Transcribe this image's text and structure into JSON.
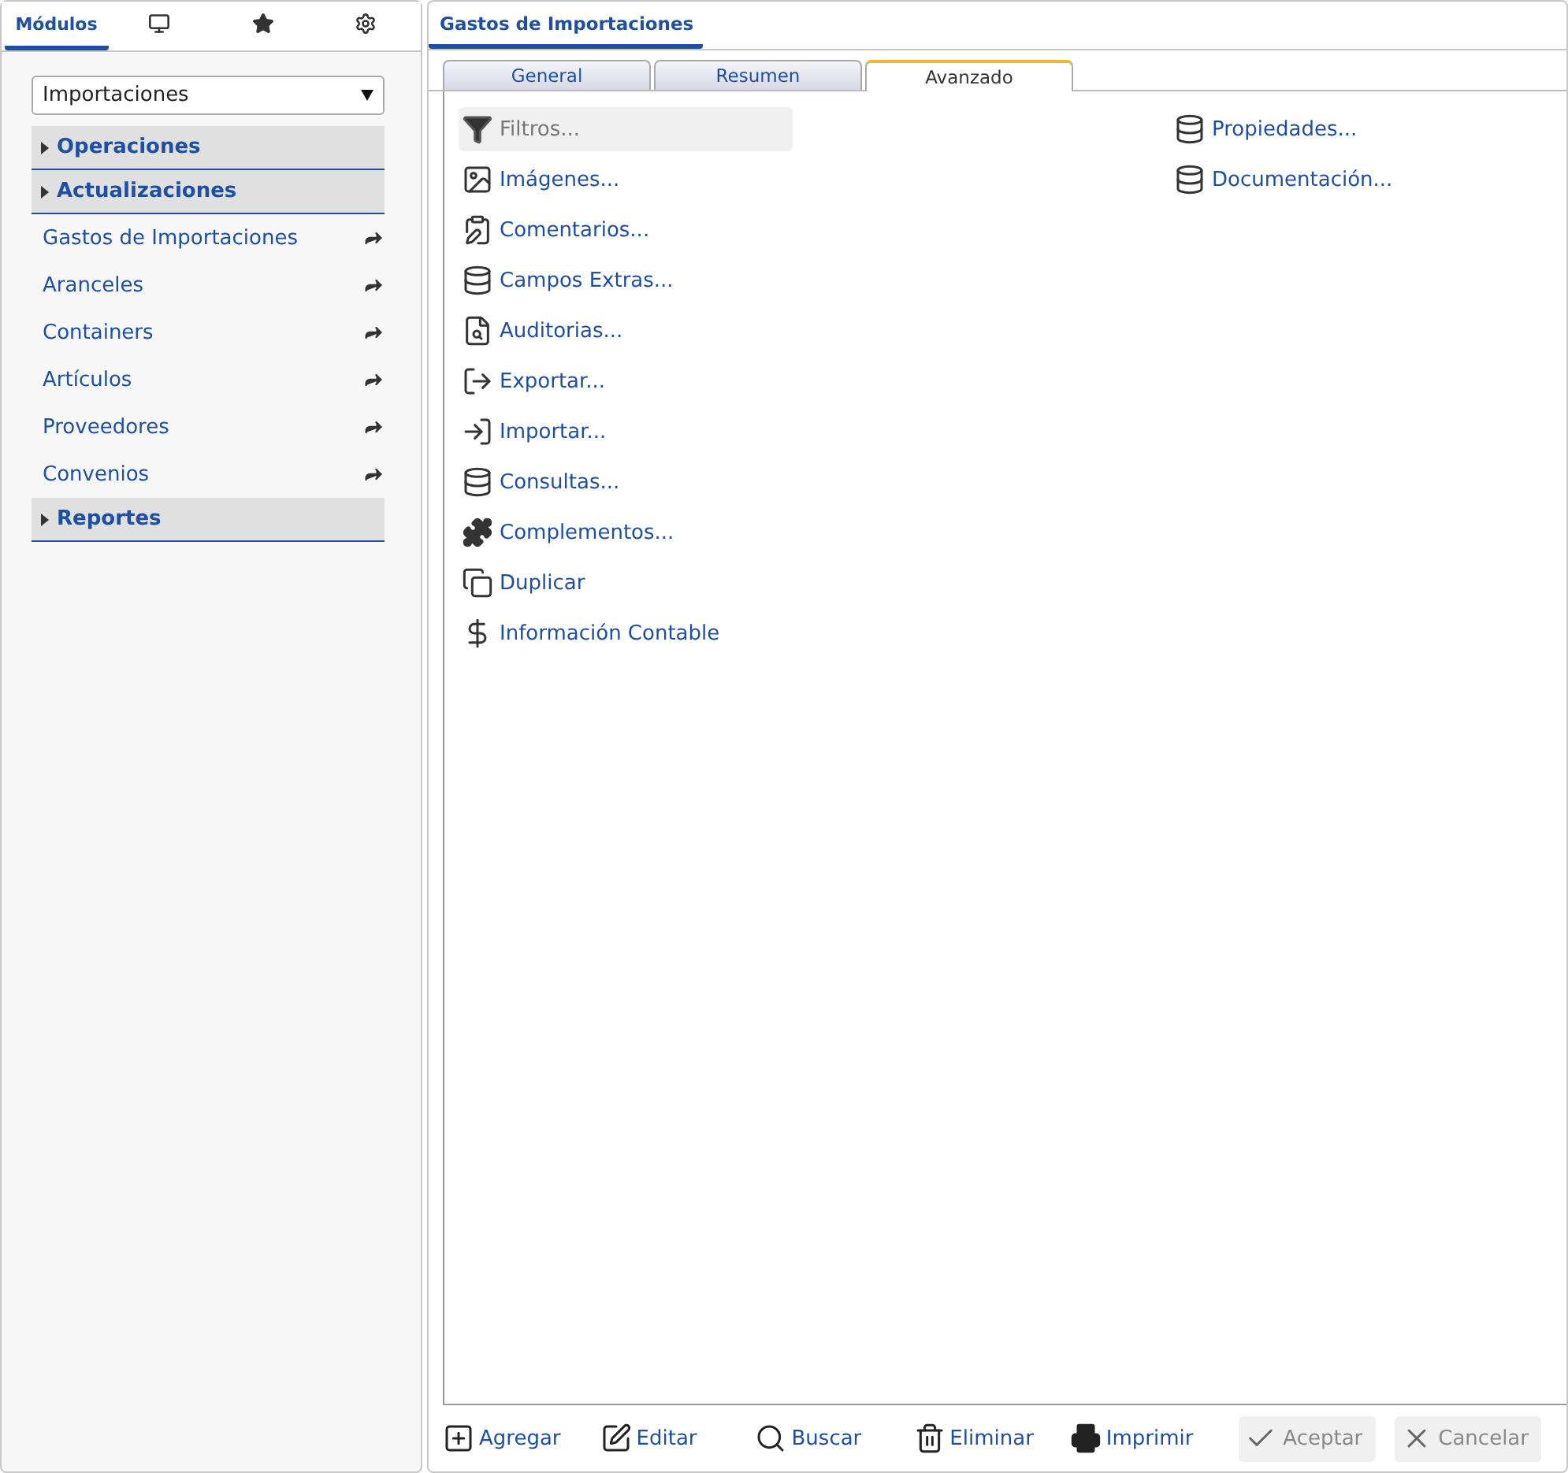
{
  "sidebar": {
    "tabs": [
      {
        "kind": "text",
        "label": "Módulos",
        "selected": true
      },
      {
        "kind": "icon",
        "selected": false
      },
      {
        "kind": "icon",
        "selected": false
      },
      {
        "kind": "icon",
        "selected": false
      }
    ],
    "module_select": {
      "value": "Importaciones"
    },
    "items": [
      {
        "kind": "section",
        "label": "Operaciones",
        "expanded": false
      },
      {
        "kind": "section",
        "label": "Actualizaciones",
        "expanded": false
      },
      {
        "kind": "link",
        "label": "Gastos de Importaciones"
      },
      {
        "kind": "link",
        "label": "Aranceles"
      },
      {
        "kind": "link",
        "label": "Containers"
      },
      {
        "kind": "link",
        "label": "Artículos"
      },
      {
        "kind": "link",
        "label": "Proveedores"
      },
      {
        "kind": "link",
        "label": "Convenios"
      },
      {
        "kind": "section",
        "label": "Reportes",
        "expanded": false
      }
    ]
  },
  "window": {
    "title": "Gastos de Importaciones"
  },
  "tabs": [
    {
      "label": "General",
      "selected": false
    },
    {
      "label": "Resumen",
      "selected": false
    },
    {
      "label": "Avanzado",
      "selected": true
    }
  ],
  "actions_left": [
    {
      "label": "Filtros...",
      "disabled": true
    },
    {
      "label": "Imágenes...",
      "disabled": false
    },
    {
      "label": "Comentarios...",
      "disabled": false
    },
    {
      "label": "Campos Extras...",
      "disabled": false
    },
    {
      "label": "Auditorias...",
      "disabled": false
    },
    {
      "label": "Exportar...",
      "disabled": false
    },
    {
      "label": "Importar...",
      "disabled": false
    },
    {
      "label": "Consultas...",
      "disabled": false
    },
    {
      "label": "Complementos...",
      "disabled": false
    },
    {
      "label": "Duplicar",
      "disabled": false
    },
    {
      "label": "Información Contable",
      "disabled": false
    }
  ],
  "actions_right": [
    {
      "label": "Propiedades...",
      "disabled": false
    },
    {
      "label": "Documentación...",
      "disabled": false
    }
  ],
  "toolbar": [
    {
      "kind": "tool",
      "label": "Agregar",
      "disabled": false
    },
    {
      "kind": "tool",
      "label": "Editar",
      "disabled": false
    },
    {
      "kind": "tool",
      "label": "Buscar",
      "disabled": false
    },
    {
      "kind": "tool",
      "label": "Eliminar",
      "disabled": false
    },
    {
      "kind": "tool",
      "label": "Imprimir",
      "disabled": false
    },
    {
      "kind": "confirm",
      "label": "Aceptar",
      "disabled": true
    },
    {
      "kind": "confirm",
      "label": "Cancelar",
      "disabled": true
    }
  ]
}
